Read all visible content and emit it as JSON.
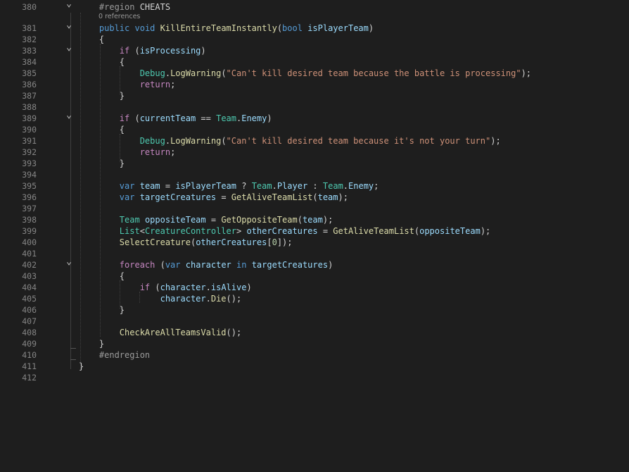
{
  "editor": {
    "colors": {
      "background": "#1e1e1e",
      "line_number": "#858585",
      "default": "#d4d4d4",
      "keyword": "#569cd6",
      "control": "#c586c0",
      "type": "#4ec9b0",
      "method": "#dcdcaa",
      "variable": "#9cdcfe",
      "string": "#ce9178",
      "number": "#b5cea8",
      "directive": "#9b9b9b",
      "codelens": "#999999"
    },
    "codelens": "0 references",
    "lines": [
      {
        "n": "380",
        "fold": true,
        "tokens": [
          [
            "    ",
            "d"
          ],
          [
            "#region",
            "p"
          ],
          [
            " CHEATS",
            "d"
          ]
        ]
      },
      {
        "n": "381",
        "fold": true,
        "tokens": [
          [
            "    ",
            "d"
          ],
          [
            "public",
            "k"
          ],
          [
            " ",
            "d"
          ],
          [
            "void",
            "k"
          ],
          [
            " ",
            "d"
          ],
          [
            "KillEntireTeamInstantly",
            "m"
          ],
          [
            "(",
            "d"
          ],
          [
            "bool",
            "k"
          ],
          [
            " ",
            "d"
          ],
          [
            "isPlayerTeam",
            "v"
          ],
          [
            ")",
            "d"
          ]
        ]
      },
      {
        "n": "382",
        "fold": false,
        "tokens": [
          [
            "    {",
            "d"
          ]
        ]
      },
      {
        "n": "383",
        "fold": true,
        "tokens": [
          [
            "        ",
            "d"
          ],
          [
            "if",
            "c"
          ],
          [
            " (",
            "d"
          ],
          [
            "isProcessing",
            "v"
          ],
          [
            ")",
            "d"
          ]
        ]
      },
      {
        "n": "384",
        "fold": false,
        "tokens": [
          [
            "        {",
            "d"
          ]
        ]
      },
      {
        "n": "385",
        "fold": false,
        "tokens": [
          [
            "            ",
            "d"
          ],
          [
            "Debug",
            "t"
          ],
          [
            ".",
            "d"
          ],
          [
            "LogWarning",
            "m"
          ],
          [
            "(",
            "d"
          ],
          [
            "\"Can't kill desired team because the battle is processing\"",
            "s"
          ],
          [
            ");",
            "d"
          ]
        ]
      },
      {
        "n": "386",
        "fold": false,
        "tokens": [
          [
            "            ",
            "d"
          ],
          [
            "return",
            "c"
          ],
          [
            ";",
            "d"
          ]
        ]
      },
      {
        "n": "387",
        "fold": false,
        "tokens": [
          [
            "        }",
            "d"
          ]
        ]
      },
      {
        "n": "388",
        "fold": false,
        "tokens": []
      },
      {
        "n": "389",
        "fold": true,
        "tokens": [
          [
            "        ",
            "d"
          ],
          [
            "if",
            "c"
          ],
          [
            " (",
            "d"
          ],
          [
            "currentTeam",
            "v"
          ],
          [
            " == ",
            "d"
          ],
          [
            "Team",
            "t"
          ],
          [
            ".",
            "d"
          ],
          [
            "Enemy",
            "v"
          ],
          [
            ")",
            "d"
          ]
        ]
      },
      {
        "n": "390",
        "fold": false,
        "tokens": [
          [
            "        {",
            "d"
          ]
        ]
      },
      {
        "n": "391",
        "fold": false,
        "tokens": [
          [
            "            ",
            "d"
          ],
          [
            "Debug",
            "t"
          ],
          [
            ".",
            "d"
          ],
          [
            "LogWarning",
            "m"
          ],
          [
            "(",
            "d"
          ],
          [
            "\"Can't kill desired team because it's not your turn\"",
            "s"
          ],
          [
            ");",
            "d"
          ]
        ]
      },
      {
        "n": "392",
        "fold": false,
        "tokens": [
          [
            "            ",
            "d"
          ],
          [
            "return",
            "c"
          ],
          [
            ";",
            "d"
          ]
        ]
      },
      {
        "n": "393",
        "fold": false,
        "tokens": [
          [
            "        }",
            "d"
          ]
        ]
      },
      {
        "n": "394",
        "fold": false,
        "tokens": []
      },
      {
        "n": "395",
        "fold": false,
        "tokens": [
          [
            "        ",
            "d"
          ],
          [
            "var",
            "k"
          ],
          [
            " ",
            "d"
          ],
          [
            "team",
            "v"
          ],
          [
            " = ",
            "d"
          ],
          [
            "isPlayerTeam",
            "v"
          ],
          [
            " ? ",
            "d"
          ],
          [
            "Team",
            "t"
          ],
          [
            ".",
            "d"
          ],
          [
            "Player",
            "v"
          ],
          [
            " : ",
            "d"
          ],
          [
            "Team",
            "t"
          ],
          [
            ".",
            "d"
          ],
          [
            "Enemy",
            "v"
          ],
          [
            ";",
            "d"
          ]
        ]
      },
      {
        "n": "396",
        "fold": false,
        "tokens": [
          [
            "        ",
            "d"
          ],
          [
            "var",
            "k"
          ],
          [
            " ",
            "d"
          ],
          [
            "targetCreatures",
            "v"
          ],
          [
            " = ",
            "d"
          ],
          [
            "GetAliveTeamList",
            "m"
          ],
          [
            "(",
            "d"
          ],
          [
            "team",
            "v"
          ],
          [
            ");",
            "d"
          ]
        ]
      },
      {
        "n": "397",
        "fold": false,
        "tokens": []
      },
      {
        "n": "398",
        "fold": false,
        "tokens": [
          [
            "        ",
            "d"
          ],
          [
            "Team",
            "t"
          ],
          [
            " ",
            "d"
          ],
          [
            "oppositeTeam",
            "v"
          ],
          [
            " = ",
            "d"
          ],
          [
            "GetOppositeTeam",
            "m"
          ],
          [
            "(",
            "d"
          ],
          [
            "team",
            "v"
          ],
          [
            ");",
            "d"
          ]
        ]
      },
      {
        "n": "399",
        "fold": false,
        "tokens": [
          [
            "        ",
            "d"
          ],
          [
            "List",
            "t"
          ],
          [
            "<",
            "d"
          ],
          [
            "CreatureController",
            "t"
          ],
          [
            "> ",
            "d"
          ],
          [
            "otherCreatures",
            "v"
          ],
          [
            " = ",
            "d"
          ],
          [
            "GetAliveTeamList",
            "m"
          ],
          [
            "(",
            "d"
          ],
          [
            "oppositeTeam",
            "v"
          ],
          [
            ");",
            "d"
          ]
        ]
      },
      {
        "n": "400",
        "fold": false,
        "tokens": [
          [
            "        ",
            "d"
          ],
          [
            "SelectCreature",
            "m"
          ],
          [
            "(",
            "d"
          ],
          [
            "otherCreatures",
            "v"
          ],
          [
            "[",
            "d"
          ],
          [
            "0",
            "n"
          ],
          [
            "]);",
            "d"
          ]
        ]
      },
      {
        "n": "401",
        "fold": false,
        "tokens": []
      },
      {
        "n": "402",
        "fold": true,
        "tokens": [
          [
            "        ",
            "d"
          ],
          [
            "foreach",
            "c"
          ],
          [
            " (",
            "d"
          ],
          [
            "var",
            "k"
          ],
          [
            " ",
            "d"
          ],
          [
            "character",
            "v"
          ],
          [
            " ",
            "d"
          ],
          [
            "in",
            "k"
          ],
          [
            " ",
            "d"
          ],
          [
            "targetCreatures",
            "v"
          ],
          [
            ")",
            "d"
          ]
        ]
      },
      {
        "n": "403",
        "fold": false,
        "tokens": [
          [
            "        {",
            "d"
          ]
        ]
      },
      {
        "n": "404",
        "fold": false,
        "tokens": [
          [
            "            ",
            "d"
          ],
          [
            "if",
            "c"
          ],
          [
            " (",
            "d"
          ],
          [
            "character",
            "v"
          ],
          [
            ".",
            "d"
          ],
          [
            "isAlive",
            "v"
          ],
          [
            ")",
            "d"
          ]
        ]
      },
      {
        "n": "405",
        "fold": false,
        "tokens": [
          [
            "                ",
            "d"
          ],
          [
            "character",
            "v"
          ],
          [
            ".",
            "d"
          ],
          [
            "Die",
            "m"
          ],
          [
            "();",
            "d"
          ]
        ]
      },
      {
        "n": "406",
        "fold": false,
        "tokens": [
          [
            "        }",
            "d"
          ]
        ]
      },
      {
        "n": "407",
        "fold": false,
        "tokens": []
      },
      {
        "n": "408",
        "fold": false,
        "tokens": [
          [
            "        ",
            "d"
          ],
          [
            "CheckAreAllTeamsValid",
            "m"
          ],
          [
            "();",
            "d"
          ]
        ]
      },
      {
        "n": "409",
        "fold": false,
        "tokens": [
          [
            "    }",
            "d"
          ]
        ]
      },
      {
        "n": "410",
        "fold": false,
        "tokens": [
          [
            "    ",
            "d"
          ],
          [
            "#endregion",
            "p"
          ]
        ]
      },
      {
        "n": "411",
        "fold": false,
        "tokens": [
          [
            "}",
            "d"
          ]
        ]
      },
      {
        "n": "412",
        "fold": false,
        "tokens": []
      }
    ]
  }
}
